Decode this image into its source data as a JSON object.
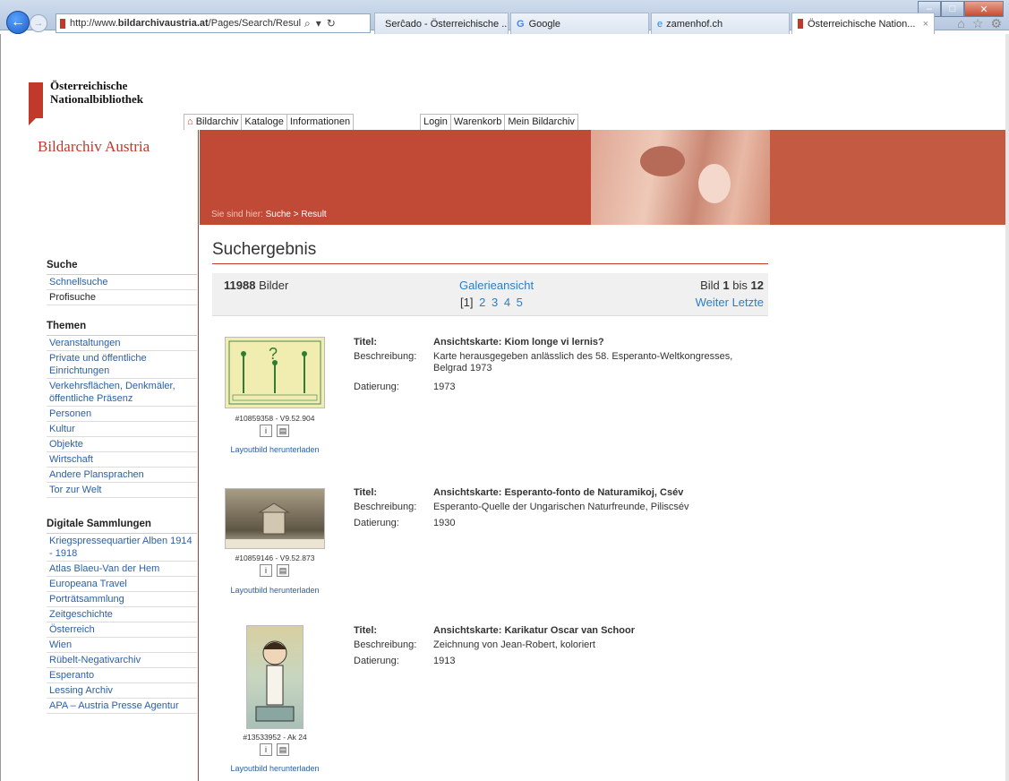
{
  "browser": {
    "url_prefix": "http://www.",
    "url_domain": "bildarchivaustria.at",
    "url_path": "/Pages/Search/Result.aspx",
    "tabs": [
      {
        "label": "Serĉado - Österreichische ...",
        "active": false
      },
      {
        "label": "Google",
        "active": false
      },
      {
        "label": "zamenhof.ch",
        "active": false
      },
      {
        "label": "Österreichische Nation...",
        "active": true
      }
    ],
    "close_tab": "×"
  },
  "logo": {
    "line1": "Österreichische",
    "line2": "Nationalbibliothek"
  },
  "topnav_left": [
    "Bildarchiv",
    "Kataloge",
    "Informationen"
  ],
  "topnav_right": [
    "Login",
    "Warenkorb",
    "Mein Bildarchiv"
  ],
  "brand": "Bildarchiv Austria",
  "breadcrumb": {
    "prefix": "Sie sind hier:",
    "path": "Suche > Result"
  },
  "sidebar": {
    "search": {
      "heading": "Suche",
      "items": [
        "Schnellsuche",
        "Profisuche"
      ]
    },
    "themes": {
      "heading": "Themen",
      "items": [
        "Veranstaltungen",
        "Private und öffentliche Einrichtungen",
        "Verkehrsflächen, Denkmäler, öffentliche Präsenz",
        "Personen",
        "Kultur",
        "Objekte",
        "Wirtschaft",
        "Andere Plansprachen",
        "Tor zur Welt"
      ]
    },
    "collections": {
      "heading": "Digitale Sammlungen",
      "items": [
        "Kriegspressequartier Alben 1914 - 1918",
        "Atlas Blaeu-Van der Hem",
        "Europeana Travel",
        "Porträtsammlung",
        "Zeitgeschichte",
        "Österreich",
        "Wien",
        "Rübelt-Negativarchiv",
        "Esperanto",
        "Lessing Archiv",
        "APA – Austria Presse Agentur"
      ]
    }
  },
  "main": {
    "title": "Suchergebnis",
    "count": "11988",
    "count_label": "Bilder",
    "gallery_link": "Galerieansicht",
    "pages": [
      "[1]",
      "2",
      "3",
      "4",
      "5"
    ],
    "range_prefix": "Bild",
    "range_from": "1",
    "range_mid": "bis",
    "range_to": "12",
    "next": "Weiter",
    "last": "Letzte"
  },
  "labels": {
    "title": "Titel:",
    "desc": "Beschreibung:",
    "date": "Datierung:",
    "download": "Layoutbild herunterladen",
    "info_icon": "i"
  },
  "results": [
    {
      "id": "#10859358 - V9.52.904",
      "title": "Ansichtskarte: Kiom longe vi lernis?",
      "desc": "Karte herausgegeben anlässlich des 58. Esperanto-Weltkongresses, Belgrad 1973",
      "date": "1973"
    },
    {
      "id": "#10859146 - V9.52.873",
      "title": "Ansichtskarte: Esperanto-fonto de Naturamikoj, Csév",
      "desc": "Esperanto-Quelle der Ungarischen Naturfreunde, Piliscsév",
      "date": "1930"
    },
    {
      "id": "#13533952 - Ak 24",
      "title": "Ansichtskarte: Karikatur Oscar van Schoor",
      "desc": "Zeichnung von Jean-Robert, koloriert",
      "date": "1913"
    }
  ]
}
